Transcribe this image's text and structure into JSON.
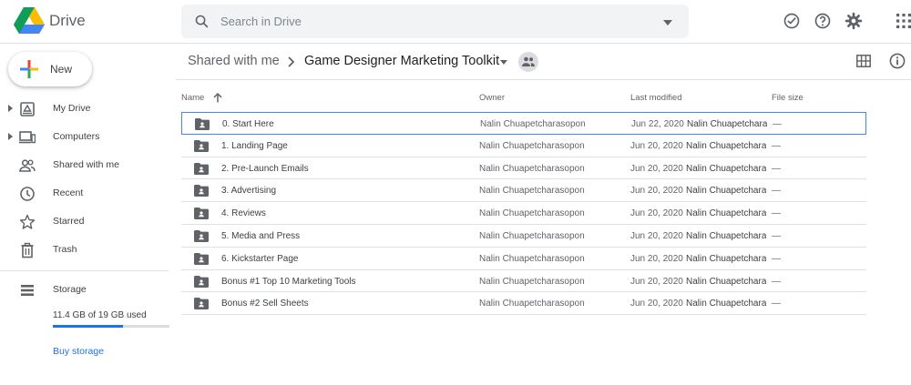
{
  "app": {
    "brand": "Drive"
  },
  "search": {
    "placeholder": "Search in Drive"
  },
  "sidebar": {
    "new_label": "New",
    "items": [
      {
        "label": "My Drive"
      },
      {
        "label": "Computers"
      },
      {
        "label": "Shared with me"
      },
      {
        "label": "Recent"
      },
      {
        "label": "Starred"
      },
      {
        "label": "Trash"
      }
    ],
    "storage": {
      "label": "Storage",
      "used_text": "11.4 GB of 19 GB used",
      "used_fraction": 0.6
    },
    "buy_label": "Buy storage"
  },
  "breadcrumb": {
    "parent": "Shared with me",
    "current": "Game Designer Marketing Toolkit"
  },
  "table": {
    "headers": {
      "name": "Name",
      "owner": "Owner",
      "modified": "Last modified",
      "size": "File size"
    },
    "rows": [
      {
        "name": "0. Start Here",
        "owner": "Nalin Chuapetcharasopon",
        "date": "Jun 22, 2020",
        "modified_by": "Nalin Chuapetchara",
        "size": "—"
      },
      {
        "name": "1. Landing Page",
        "owner": "Nalin Chuapetcharasopon",
        "date": "Jun 20, 2020",
        "modified_by": "Nalin Chuapetchara",
        "size": "—"
      },
      {
        "name": "2. Pre-Launch Emails",
        "owner": "Nalin Chuapetcharasopon",
        "date": "Jun 20, 2020",
        "modified_by": "Nalin Chuapetchara",
        "size": "—"
      },
      {
        "name": "3. Advertising",
        "owner": "Nalin Chuapetcharasopon",
        "date": "Jun 20, 2020",
        "modified_by": "Nalin Chuapetchara",
        "size": "—"
      },
      {
        "name": "4. Reviews",
        "owner": "Nalin Chuapetcharasopon",
        "date": "Jun 20, 2020",
        "modified_by": "Nalin Chuapetchara",
        "size": "—"
      },
      {
        "name": "5. Media and Press",
        "owner": "Nalin Chuapetcharasopon",
        "date": "Jun 20, 2020",
        "modified_by": "Nalin Chuapetchara",
        "size": "—"
      },
      {
        "name": "6. Kickstarter Page",
        "owner": "Nalin Chuapetcharasopon",
        "date": "Jun 20, 2020",
        "modified_by": "Nalin Chuapetchara",
        "size": "—"
      },
      {
        "name": "Bonus #1 Top 10 Marketing Tools",
        "owner": "Nalin Chuapetcharasopon",
        "date": "Jun 20, 2020",
        "modified_by": "Nalin Chuapetchara",
        "size": "—"
      },
      {
        "name": "Bonus #2 Sell Sheets",
        "owner": "Nalin Chuapetcharasopon",
        "date": "Jun 20, 2020",
        "modified_by": "Nalin Chuapetchara",
        "size": "—"
      }
    ]
  },
  "colors": {
    "accent": "#1a73e8",
    "selected_border": "#4285f4",
    "icon": "#5f6368"
  }
}
